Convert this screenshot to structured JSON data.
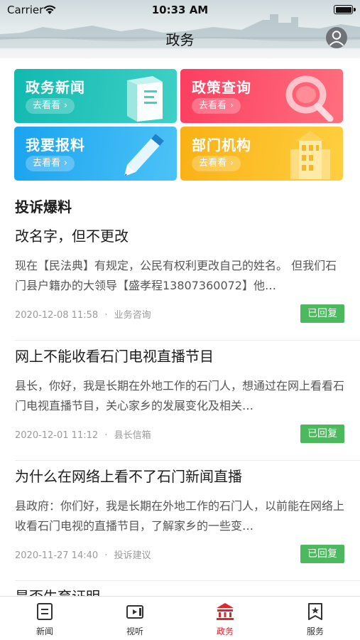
{
  "status_bar": {
    "carrier": "Carrier",
    "time": "10:33 AM"
  },
  "header": {
    "title": "政务"
  },
  "cards": [
    {
      "title": "政务新闻",
      "button": "去看看",
      "art_text": "政务新闻",
      "color": "#11b9b0"
    },
    {
      "title": "政策查询",
      "button": "去看看",
      "color": "#fb3e5f"
    },
    {
      "title": "我要报料",
      "button": "去看看",
      "color": "#1aa3ef"
    },
    {
      "title": "部门机构",
      "button": "去看看",
      "color": "#f9b114"
    }
  ],
  "section": {
    "title": "投诉爆料"
  },
  "items": [
    {
      "title": "改名字，但不更改",
      "description": "现在【民法典】有规定，公民有权利更改自己的姓名。 但我们石门县户籍办的大领导【盛孝程13807360072】他…",
      "date": "2020-12-08 11:58",
      "category": "业务咨询",
      "status": "已回复"
    },
    {
      "title": "网上不能收看石门电视直播节目",
      "description": "县长，你好，我是长期在外地工作的石门人，想通过在网上看看石门电视直播节目，关心家乡的发展变化及相关…",
      "date": "2020-12-01 11:12",
      "category": "县长信箱",
      "status": "已回复"
    },
    {
      "title": "为什么在网络上看不了石门新闻直播",
      "description": "县政府：你们好，我是长期在外地工作的石门人，以前能在网络上收看石门电视的直播节目，了解家乡的一些变…",
      "date": "2020-11-27 14:40",
      "category": "投诉建议",
      "status": "已回复"
    }
  ],
  "partial_item": {
    "title": "是否生育证明"
  },
  "meta_separator": "·",
  "tabs": [
    {
      "label": "新闻",
      "icon": "news-icon",
      "active": false
    },
    {
      "label": "视听",
      "icon": "video-icon",
      "active": false
    },
    {
      "label": "政务",
      "icon": "government-icon",
      "active": true
    },
    {
      "label": "服务",
      "icon": "service-icon",
      "active": false
    }
  ],
  "colors": {
    "accent": "#e0262f",
    "badge": "#4cb95e"
  }
}
